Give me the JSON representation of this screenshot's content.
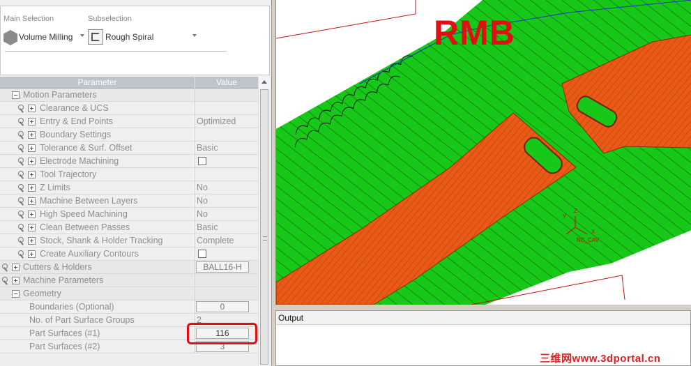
{
  "selection": {
    "main_label": "Main Selection",
    "main_value": "Volume Milling",
    "sub_label": "Subselection",
    "sub_value": "Rough Spiral"
  },
  "table": {
    "header_parameter": "Parameter",
    "header_value": "Value",
    "rows": [
      {
        "name": "Motion Parameters",
        "value": ""
      },
      {
        "name": "Clearance & UCS",
        "value": ""
      },
      {
        "name": "Entry & End Points",
        "value": "Optimized"
      },
      {
        "name": "Boundary Settings",
        "value": ""
      },
      {
        "name": "Tolerance & Surf. Offset",
        "value": "Basic"
      },
      {
        "name": "Electrode Machining",
        "value": ""
      },
      {
        "name": "Tool Trajectory",
        "value": ""
      },
      {
        "name": "Z Limits",
        "value": "No"
      },
      {
        "name": "Machine Between Layers",
        "value": "No"
      },
      {
        "name": "High Speed Machining",
        "value": "No"
      },
      {
        "name": "Clean Between Passes",
        "value": "Basic"
      },
      {
        "name": "Stock, Shank & Holder Tracking",
        "value": "Complete"
      },
      {
        "name": "Create Auxiliary Contours",
        "value": ""
      },
      {
        "name": "Cutters & Holders",
        "value": "BALL16-H"
      },
      {
        "name": "Machine Parameters",
        "value": ""
      },
      {
        "name": "Geometry",
        "value": ""
      },
      {
        "name": "Boundaries (Optional)",
        "value": "0"
      },
      {
        "name": "No. of Part Surface Groups",
        "value": "2"
      },
      {
        "name": "Part Surfaces (#1)",
        "value": "116"
      },
      {
        "name": "Part Surfaces (#2)",
        "value": "3"
      }
    ]
  },
  "viewport": {
    "overlay_text": "RMB",
    "axis_label": "NC_CAV",
    "axis_x": "X",
    "axis_y": "Y",
    "axis_z": "Z"
  },
  "output": {
    "title": "Output"
  },
  "watermark": "三维网www.3dportal.cn",
  "colors": {
    "surface_green": "#18c818",
    "part_orange": "#e85a16",
    "highlight_red": "#e01010"
  }
}
